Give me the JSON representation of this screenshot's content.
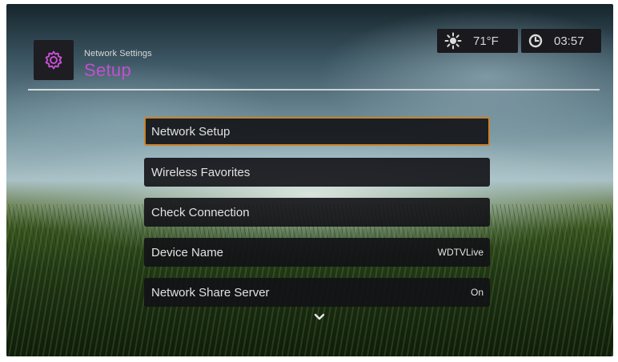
{
  "header": {
    "breadcrumb": "Network Settings",
    "title": "Setup",
    "app_icon": "gear-icon",
    "title_color": "#c34fd0"
  },
  "status": {
    "weather_icon": "sun-icon",
    "temperature": "71°F",
    "clock_icon": "clock-icon",
    "time": "03:57"
  },
  "menu": {
    "items": [
      {
        "label": "Network Setup",
        "value": "",
        "selected": true
      },
      {
        "label": "Wireless Favorites",
        "value": ""
      },
      {
        "label": "Check Connection",
        "value": ""
      },
      {
        "label": "Device Name",
        "value": "WDTVLive"
      },
      {
        "label": "Network Share Server",
        "value": "On"
      }
    ],
    "more_icon": "chevron-down-icon",
    "selection_color": "#c9822a"
  }
}
